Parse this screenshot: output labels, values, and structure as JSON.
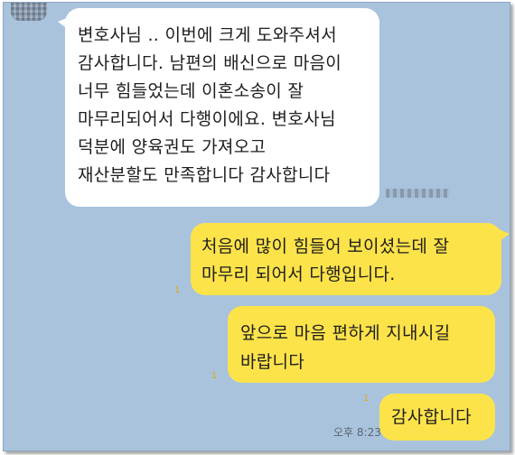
{
  "chat": {
    "received": {
      "lines": [
        "변호사님 .. 이번에 크게 도와주셔서",
        "감사합니다. 남편의 배신으로 마음이",
        "너무 힘들었는데 이혼소송이 잘",
        "마무리되어서 다행이에요. 변호사님",
        "덕분에 양육권도 가져오고",
        "재산분할도 만족합니다 감사합니다"
      ]
    },
    "sent": [
      {
        "lines": [
          "처음에 많이 힘들어 보이셨는데 잘",
          "마무리 되어서 다행입니다."
        ],
        "read_count": "1"
      },
      {
        "lines": [
          "앞으로 마음 편하게 지내시길",
          "바랍니다"
        ],
        "read_count": "1"
      },
      {
        "lines": [
          "감사합니다"
        ],
        "read_count": "1"
      }
    ],
    "last_time": "오후 8:23"
  },
  "colors": {
    "chat_background": "#a9c3dd",
    "sent_bubble": "#fde34a",
    "received_bubble": "#ffffff",
    "read_count": "#e2a80f"
  }
}
